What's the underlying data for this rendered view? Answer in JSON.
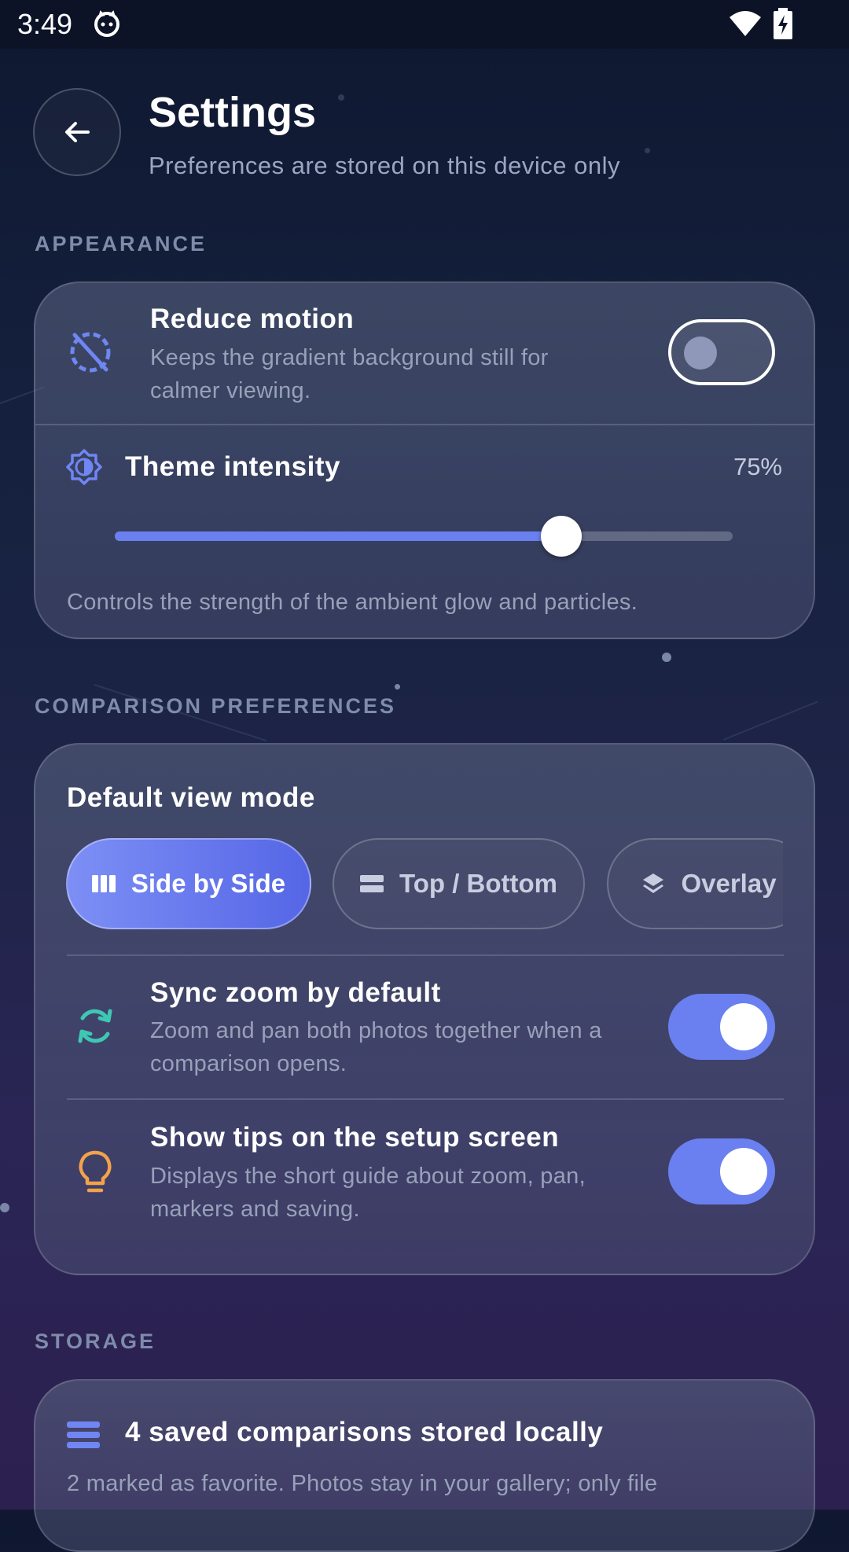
{
  "status_bar": {
    "time": "3:49",
    "icons": [
      "cat-icon",
      "wifi-icon",
      "battery-charging-icon"
    ]
  },
  "header": {
    "title": "Settings",
    "subtitle": "Preferences are stored on this device only",
    "back_icon": "arrow-left-icon"
  },
  "appearance": {
    "section_label": "APPEARANCE",
    "reduce_motion": {
      "title": "Reduce motion",
      "description": "Keeps the gradient background still for calmer viewing.",
      "enabled": false,
      "icon": "motion-off-icon"
    },
    "theme_intensity": {
      "title": "Theme intensity",
      "value_text": "75%",
      "value": 0.75,
      "description": "Controls the strength of the ambient glow and particles.",
      "icon": "brightness-icon"
    }
  },
  "comparison": {
    "section_label": "COMPARISON PREFERENCES",
    "view_mode": {
      "title": "Default view mode",
      "options": [
        {
          "label": "Side by Side",
          "icon": "columns-icon",
          "selected": true
        },
        {
          "label": "Top / Bottom",
          "icon": "rows-icon",
          "selected": false
        },
        {
          "label": "Overlay",
          "icon": "layers-icon",
          "selected": false
        }
      ]
    },
    "sync_zoom": {
      "title": "Sync zoom by default",
      "description": "Zoom and pan both photos together when a comparison opens.",
      "enabled": true,
      "icon": "sync-icon"
    },
    "show_tips": {
      "title": "Show tips on the setup screen",
      "description": "Displays the short guide about zoom, pan, markers and saving.",
      "enabled": true,
      "icon": "lightbulb-icon"
    }
  },
  "storage": {
    "section_label": "STORAGE",
    "summary": "4 saved comparisons stored locally",
    "description": "2 marked as favorite. Photos stay in your gallery; only file",
    "icon": "storage-list-icon"
  },
  "colors": {
    "accent": "#6a80f0",
    "sync_icon": "#3ec8b4",
    "tips_icon": "#f2a24a",
    "brightness_icon": "#6f86f3"
  }
}
